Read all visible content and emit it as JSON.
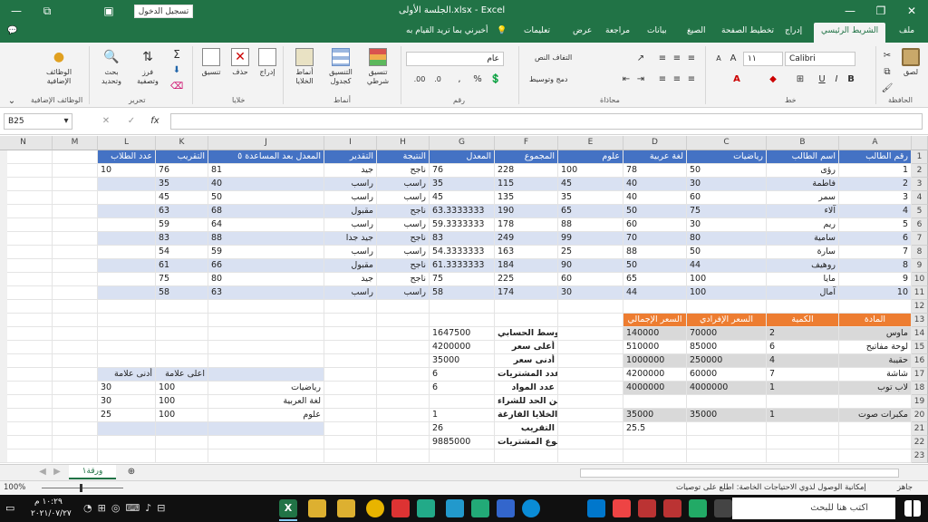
{
  "window": {
    "title": "الجلسة الأولى.xlsx  -  Excel",
    "signin": "تسجيل الدخول"
  },
  "tabs": [
    "ملف",
    "الشريط الرئيسي",
    "إدراج",
    "تخطيط الصفحة",
    "الصيغ",
    "بيانات",
    "مراجعة",
    "عرض",
    "تعليمات"
  ],
  "tell_me": "أخبرني بما تريد القيام به",
  "ribbon": {
    "font_name": "Calibri",
    "font_size": "١١",
    "number_format": "عام",
    "groups": [
      "الحافظة",
      "خط",
      "محاذاة",
      "رقم",
      "أنماط",
      "خلايا",
      "تحرير",
      "الوظائف الإضافية"
    ],
    "buttons": {
      "paste": "لصق",
      "wrap": "التفاف النص",
      "merge": "دمج وتوسيط",
      "cond": "تنسيق شرطي",
      "as_table": "التنسيق كجدول",
      "cell_styles": "أنماط الخلايا",
      "insert": "إدراج",
      "delete": "حذف",
      "format": "تنسيق",
      "sort": "فرز وتصفية",
      "find": "بحث وتحديد",
      "addins": "الوظائف الإضافية"
    }
  },
  "namebox": "B25",
  "fx": "fx",
  "columns": [
    "A",
    "B",
    "C",
    "D",
    "E",
    "F",
    "G",
    "H",
    "I",
    "J",
    "K",
    "L",
    "M",
    "N"
  ],
  "rows": [
    "1",
    "2",
    "3",
    "4",
    "5",
    "6",
    "7",
    "8",
    "9",
    "10",
    "11",
    "12",
    "13",
    "14",
    "15",
    "16",
    "17",
    "18",
    "19",
    "20",
    "21",
    "22",
    "23"
  ],
  "main_table": {
    "headers": [
      "رقم الطالب",
      "اسم الطالب",
      "رياضيات",
      "لغة عربية",
      "علوم",
      "المجموع",
      "المعدل",
      "النتيجة",
      "التقدير",
      "المعدل بعد المساعدة ٥",
      "التقريب",
      "عدد الطلاب"
    ],
    "rows": [
      [
        "1",
        "رؤى",
        "50",
        "78",
        "100",
        "228",
        "76",
        "ناجح",
        "جيد",
        "81",
        "76",
        "10"
      ],
      [
        "2",
        "فاطمة",
        "30",
        "40",
        "45",
        "115",
        "35",
        "راسب",
        "راسب",
        "40",
        "35",
        ""
      ],
      [
        "3",
        "سمر",
        "60",
        "40",
        "35",
        "135",
        "45",
        "راسب",
        "راسب",
        "50",
        "45",
        ""
      ],
      [
        "4",
        "آلاء",
        "75",
        "50",
        "65",
        "190",
        "63.3333333",
        "ناجح",
        "مقبول",
        "68",
        "63",
        ""
      ],
      [
        "5",
        "ريم",
        "30",
        "60",
        "88",
        "178",
        "59.3333333",
        "راسب",
        "راسب",
        "64",
        "59",
        ""
      ],
      [
        "6",
        "سامية",
        "80",
        "70",
        "99",
        "249",
        "83",
        "ناجح",
        "جيد جدا",
        "88",
        "83",
        ""
      ],
      [
        "7",
        "سارة",
        "50",
        "88",
        "25",
        "163",
        "54.3333333",
        "راسب",
        "راسب",
        "59",
        "54",
        ""
      ],
      [
        "8",
        "روهيف",
        "44",
        "50",
        "90",
        "184",
        "61.3333333",
        "ناجح",
        "مقبول",
        "66",
        "61",
        ""
      ],
      [
        "9",
        "مايا",
        "100",
        "65",
        "60",
        "225",
        "75",
        "ناجح",
        "جيد",
        "80",
        "75",
        ""
      ],
      [
        "10",
        "آمال",
        "100",
        "44",
        "30",
        "174",
        "58",
        "راسب",
        "راسب",
        "63",
        "58",
        ""
      ]
    ]
  },
  "products": {
    "headers": [
      "المادة",
      "الكمية",
      "السعر الإفرادي",
      "السعر الإجمالي"
    ],
    "rows": [
      [
        "ماوس",
        "2",
        "70000",
        "140000"
      ],
      [
        "لوحة مفاتيح",
        "6",
        "85000",
        "510000"
      ],
      [
        "حقيبة",
        "4",
        "250000",
        "1000000"
      ],
      [
        "شاشة",
        "7",
        "60000",
        "4200000"
      ],
      [
        "لاب توب",
        "1",
        "4000000",
        "4000000"
      ],
      [
        "",
        "",
        " ",
        ""
      ],
      [
        "مكبرات صوت",
        "1",
        "35000",
        "35000"
      ],
      [
        "",
        "",
        "",
        "25.5"
      ]
    ]
  },
  "stats": [
    [
      "متوسط الحسابي",
      "1647500"
    ],
    [
      "أعلى سعر",
      "4200000"
    ],
    [
      "أدنى سعر",
      "35000"
    ],
    [
      "عدد المشتريات",
      "6"
    ],
    [
      "عدد المواد",
      "6"
    ],
    [
      "لا انت تعديت الحد ضمن الحد للشراء",
      ""
    ],
    [
      "عدد الخلايا الفارغة",
      "1"
    ],
    [
      "التقريب",
      "26"
    ],
    [
      "مجموع المشتريات",
      "9885000"
    ]
  ],
  "grades": {
    "headers": [
      "أدنى علامة",
      "اعلى علامة",
      ""
    ],
    "rows": [
      [
        "30",
        "100",
        "رياضيات"
      ],
      [
        "30",
        "100",
        "لغة العربية"
      ],
      [
        "25",
        "100",
        "علوم"
      ]
    ]
  },
  "sheet_tab": "ورقة١",
  "status": {
    "ready": "جاهز",
    "accessibility": "إمكانية الوصول لذوي الاحتياجات الخاصة: اطلع على توصيات",
    "zoom": "100%"
  },
  "taskbar": {
    "search": "اكتب هنا للبحث",
    "time": "١٠:٢٩ م",
    "date": "٢٠٢١/٠٧/٢٧"
  },
  "colors": {
    "excel_green": "#217346",
    "header_blue": "#4472c4",
    "stripe": "#d9e1f2",
    "orange": "#ed7d31"
  }
}
